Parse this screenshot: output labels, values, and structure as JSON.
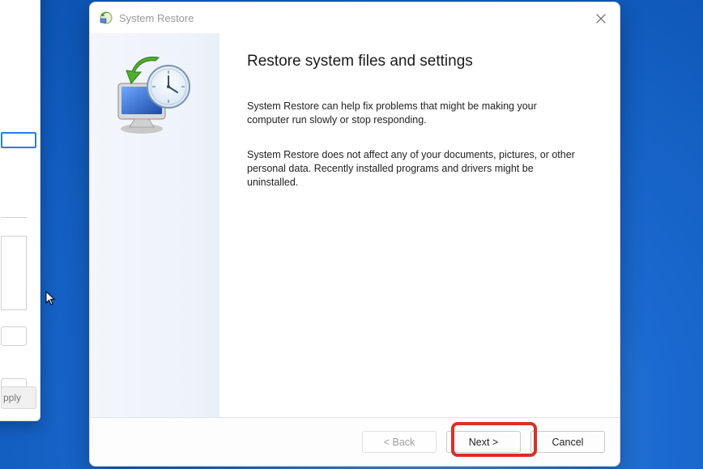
{
  "under": {
    "apply_label": "pply"
  },
  "dialog": {
    "title": "System Restore",
    "heading": "Restore system files and settings",
    "paragraph1": "System Restore can help fix problems that might be making your computer run slowly or stop responding.",
    "paragraph2": "System Restore does not affect any of your documents, pictures, or other personal data. Recently installed programs and drivers might be uninstalled.",
    "buttons": {
      "back": "< Back",
      "next": "Next >",
      "cancel": "Cancel"
    }
  }
}
